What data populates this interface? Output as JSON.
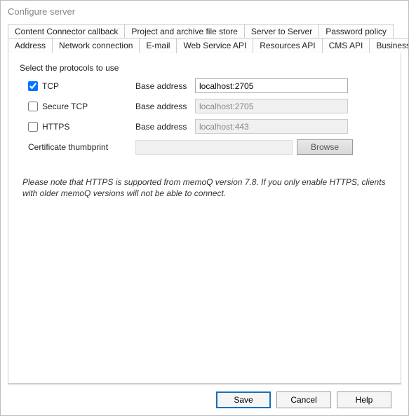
{
  "window": {
    "title": "Configure server"
  },
  "tabs": {
    "row1": [
      {
        "label": "Content Connector callback"
      },
      {
        "label": "Project and archive file store"
      },
      {
        "label": "Server to Server"
      },
      {
        "label": "Password policy"
      }
    ],
    "row2": [
      {
        "label": "Address"
      },
      {
        "label": "Network connection"
      },
      {
        "label": "E-mail"
      },
      {
        "label": "Web Service API"
      },
      {
        "label": "Resources API"
      },
      {
        "label": "CMS API"
      },
      {
        "label": "Business Analytics API"
      }
    ],
    "active": "Network connection"
  },
  "section": {
    "heading": "Select the protocols to use",
    "protocols": [
      {
        "name": "TCP",
        "checked": true,
        "addr_label": "Base address",
        "addr_value": "localhost:2705",
        "disabled": false
      },
      {
        "name": "Secure TCP",
        "checked": false,
        "addr_label": "Base address",
        "addr_value": "localhost:2705",
        "disabled": true
      },
      {
        "name": "HTTPS",
        "checked": false,
        "addr_label": "Base address",
        "addr_value": "localhost:443",
        "disabled": true
      }
    ],
    "cert_label": "Certificate thumbprint",
    "cert_value": "",
    "browse_label": "Browse",
    "note": "Please note that HTTPS is supported from memoQ version 7.8. If you only enable HTTPS, clients with older memoQ versions will not be able to connect."
  },
  "buttons": {
    "save": "Save",
    "cancel": "Cancel",
    "help": "Help"
  }
}
